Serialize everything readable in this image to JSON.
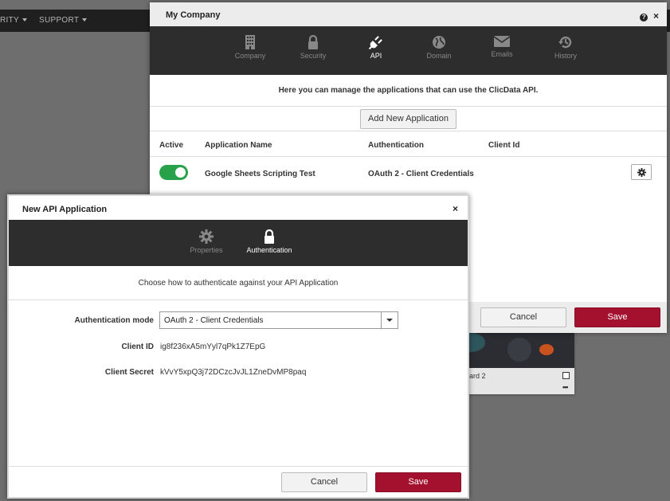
{
  "background": {
    "nav": [
      {
        "label": "RITY"
      },
      {
        "label": "SUPPORT"
      }
    ],
    "card_label": "ard 2"
  },
  "company_modal": {
    "title": "My Company",
    "help_icon": "?",
    "close_icon": "×",
    "tabs": [
      {
        "label": "Company",
        "icon": "building-icon"
      },
      {
        "label": "Security",
        "icon": "lock-icon"
      },
      {
        "label": "API",
        "icon": "plug-icon",
        "active": true
      },
      {
        "label": "Domain",
        "icon": "globe-icon"
      },
      {
        "label": "Emails",
        "icon": "envelope-icon"
      },
      {
        "label": "History",
        "icon": "history-icon"
      }
    ],
    "intro": "Here you can manage the applications that can use the ClicData API.",
    "add_button": "Add New Application",
    "columns": [
      "Active",
      "Application Name",
      "Authentication",
      "Client Id"
    ],
    "rows": [
      {
        "active": true,
        "name": "Google Sheets Scripting Test",
        "authentication": "OAuth 2 - Client Credentials",
        "client_id": ""
      }
    ],
    "cancel_label": "Cancel",
    "save_label": "Save"
  },
  "api_modal": {
    "title": "New API Application",
    "close_icon": "×",
    "tabs": [
      {
        "label": "Properties",
        "icon": "gear-icon"
      },
      {
        "label": "Authentication",
        "icon": "lock-icon",
        "active": true
      }
    ],
    "description": "Choose how to authenticate against your API Application",
    "auth_mode_label": "Authentication mode",
    "auth_mode_value": "OAuth 2 - Client Credentials",
    "client_id_label": "Client ID",
    "client_id_value": "ig8f236xA5mYyl7qPk1Z7EpG",
    "client_secret_label": "Client Secret",
    "client_secret_value": "kVvY5xpQ3j72DCzcJvJL1ZneDvMP8paq",
    "cancel_label": "Cancel",
    "save_label": "Save"
  },
  "colors": {
    "accent": "#a3112f",
    "toggle_on": "#27a24a",
    "tabbar": "#2d2d2d"
  }
}
